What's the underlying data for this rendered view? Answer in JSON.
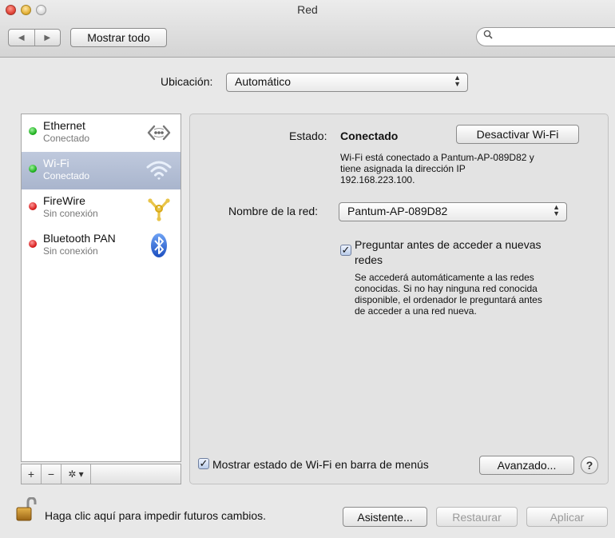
{
  "window": {
    "title": "Red"
  },
  "toolbar": {
    "back_glyph": "◀",
    "forward_glyph": "▶",
    "show_all_label": "Mostrar todo",
    "search_placeholder": "",
    "search_glyph": "🔍"
  },
  "location": {
    "label": "Ubicación:",
    "value": "Automático"
  },
  "services": [
    {
      "name": "Ethernet",
      "status": "Conectado",
      "dot": "green",
      "icon": "ethernet-icon"
    },
    {
      "name": "Wi-Fi",
      "status": "Conectado",
      "dot": "green",
      "icon": "wifi-icon",
      "selected": true
    },
    {
      "name": "FireWire",
      "status": "Sin conexión",
      "dot": "red",
      "icon": "firewire-icon"
    },
    {
      "name": "Bluetooth PAN",
      "status": "Sin conexión",
      "dot": "red",
      "icon": "bluetooth-icon"
    }
  ],
  "sidebar_tools": {
    "add": "+",
    "remove": "−",
    "gear": "✲ ▾"
  },
  "detail": {
    "status_label": "Estado:",
    "status_value": "Conectado",
    "toggle_wifi_label": "Desactivar Wi-Fi",
    "status_description": [
      "Wi-Fi está conectado a Pantum-AP-089D82 y",
      "tiene asignada la dirección IP",
      "192.168.223.100."
    ],
    "network_name_label": "Nombre de la red:",
    "network_name_value": "Pantum-AP-089D82",
    "ask_join_label_line1": "Preguntar antes de acceder a nuevas",
    "ask_join_label_line2": "redes",
    "ask_join_checked": true,
    "ask_join_description": [
      "Se accederá automáticamente a las redes",
      "conocidas. Si no hay ninguna red conocida",
      "disponible, el ordenador le preguntará antes",
      "de acceder a una red nueva."
    ],
    "show_status_label": "Mostrar estado de Wi-Fi en barra de menús",
    "show_status_checked": true,
    "advanced_label": "Avanzado...",
    "help_label": "?"
  },
  "footer": {
    "lock_text": "Haga clic aquí para impedir futuros cambios.",
    "assistant_label": "Asistente...",
    "revert_label": "Restaurar",
    "apply_label": "Aplicar"
  },
  "colors": {
    "selection": "#aab6ce",
    "connected": "#1aae1a",
    "disconnected": "#d61a1a",
    "checkbox": "#b9cbe8"
  }
}
